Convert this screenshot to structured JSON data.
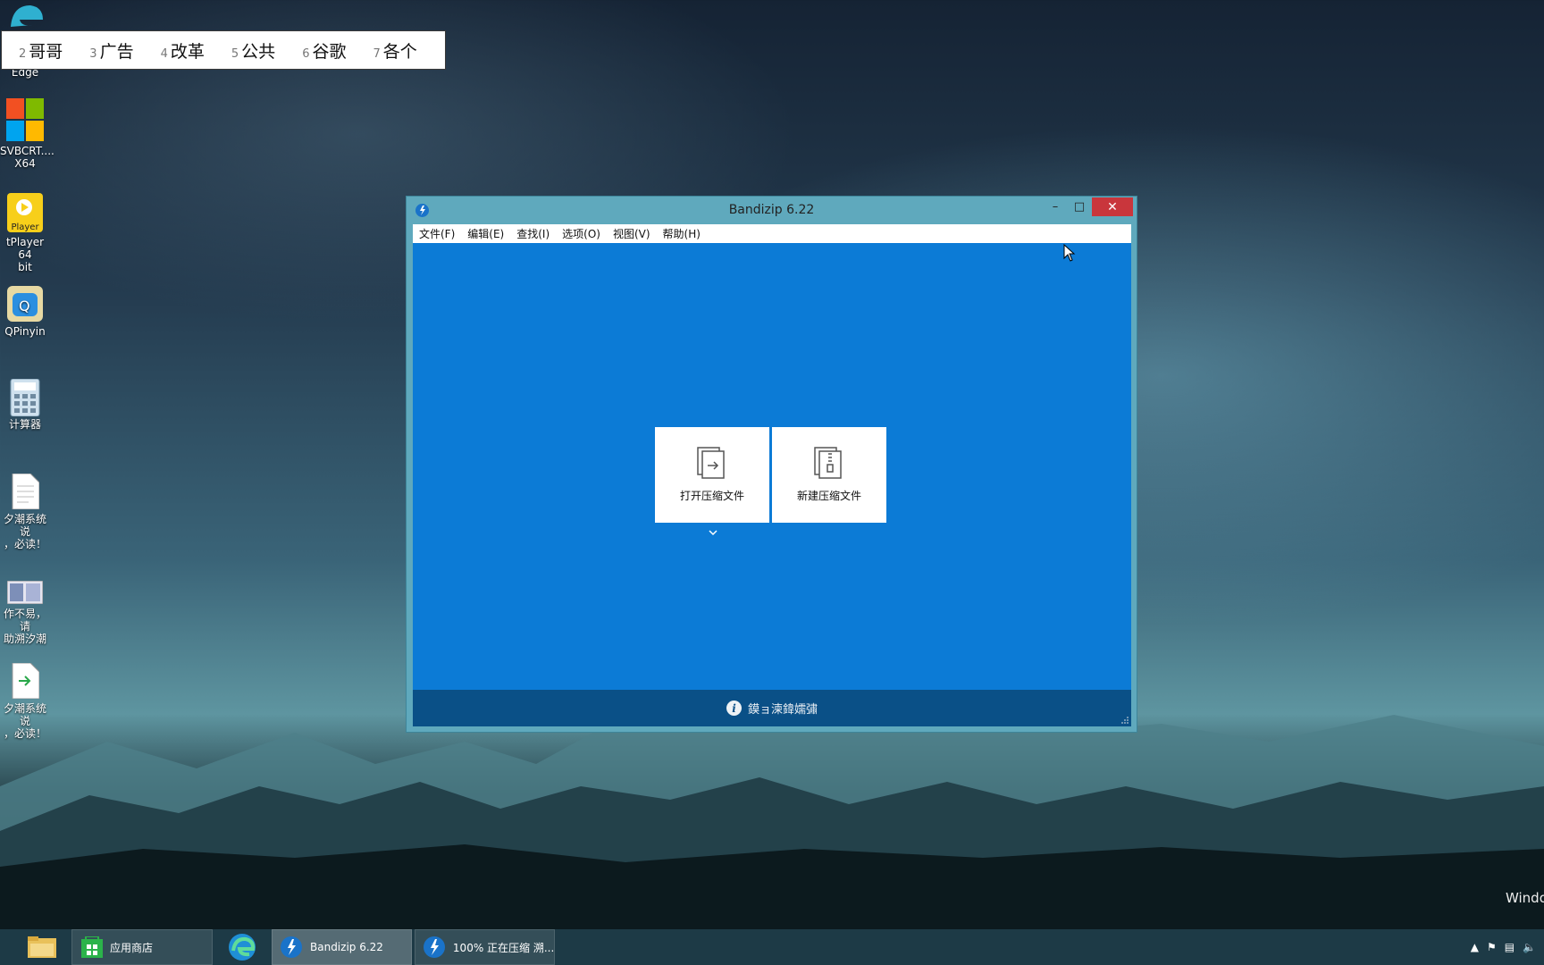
{
  "ime": {
    "candidates": [
      {
        "num": "2",
        "word": "哥哥"
      },
      {
        "num": "3",
        "word": "广告"
      },
      {
        "num": "4",
        "word": "改革"
      },
      {
        "num": "5",
        "word": "公共"
      },
      {
        "num": "6",
        "word": "谷歌"
      },
      {
        "num": "7",
        "word": "各个"
      }
    ]
  },
  "desktop": {
    "icons": [
      {
        "label": "Edge"
      },
      {
        "label": "SVBCRT....\nX64"
      },
      {
        "label": "tPlayer 64\nbit"
      },
      {
        "label": "QPinyin"
      },
      {
        "label": "计算器"
      },
      {
        "label": "夕潮系统说\n，必读！"
      },
      {
        "label": "作不易，请\n助溯汐潮"
      },
      {
        "label": "夕潮系统说\n，必读！"
      }
    ],
    "player_badge": "Player"
  },
  "window": {
    "title": "Bandizip 6.22",
    "menu": [
      "文件(F)",
      "编辑(E)",
      "查找(I)",
      "选项(O)",
      "视图(V)",
      "帮助(H)"
    ],
    "tiles": {
      "open_label": "打开压缩文件",
      "new_label": "新建压缩文件"
    },
    "status_text": "鏌ョ湅鍏嬬彇"
  },
  "watermark": "Windo",
  "taskbar": {
    "store_label": "应用商店",
    "bandizip_label": "Bandizip 6.22",
    "progress_label": "100% 正在压缩 溯..."
  },
  "colors": {
    "client_bg": "#0c7bd6",
    "statusbar_bg": "#0a5087",
    "close_btn": "#c9363c",
    "taskbar_bg": "#1d3a46"
  }
}
